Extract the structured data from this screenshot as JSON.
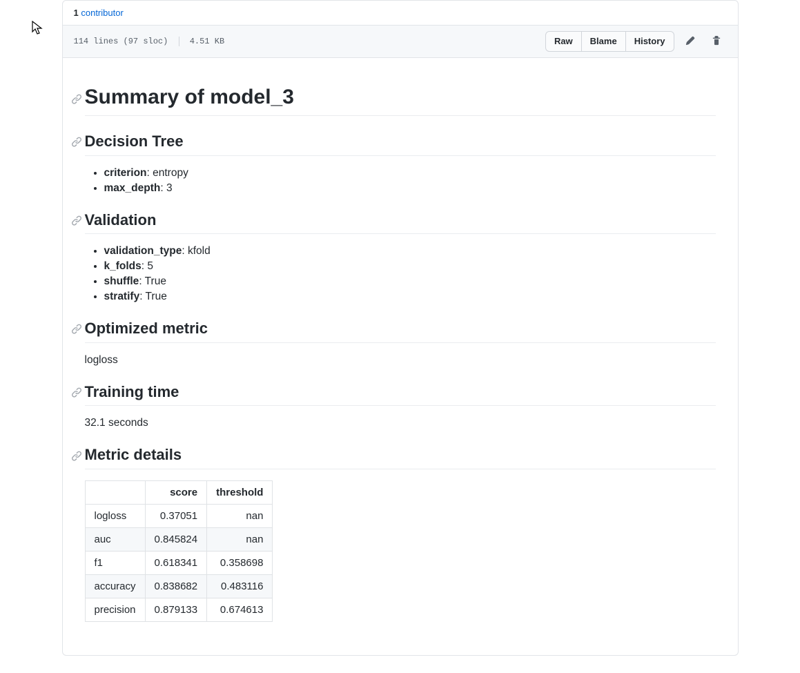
{
  "contrib": {
    "count": "1",
    "label": "contributor"
  },
  "file_info": {
    "lines_sloc": "114 lines (97 sloc)",
    "size": "4.51 KB"
  },
  "toolbar": {
    "raw": "Raw",
    "blame": "Blame",
    "history": "History"
  },
  "doc": {
    "h1": "Summary of model_3",
    "sections": {
      "decision_tree": {
        "heading": "Decision Tree",
        "items": [
          {
            "key": "criterion",
            "val": ": entropy"
          },
          {
            "key": "max_depth",
            "val": ": 3"
          }
        ]
      },
      "validation": {
        "heading": "Validation",
        "items": [
          {
            "key": "validation_type",
            "val": ": kfold"
          },
          {
            "key": "k_folds",
            "val": ": 5"
          },
          {
            "key": "shuffle",
            "val": ": True"
          },
          {
            "key": "stratify",
            "val": ": True"
          }
        ]
      },
      "optimized_metric": {
        "heading": "Optimized metric",
        "text": "logloss"
      },
      "training_time": {
        "heading": "Training time",
        "text": "32.1 seconds"
      },
      "metric_details": {
        "heading": "Metric details",
        "headers": [
          "",
          "score",
          "threshold"
        ],
        "rows": [
          [
            "logloss",
            "0.37051",
            "nan"
          ],
          [
            "auc",
            "0.845824",
            "nan"
          ],
          [
            "f1",
            "0.618341",
            "0.358698"
          ],
          [
            "accuracy",
            "0.838682",
            "0.483116"
          ],
          [
            "precision",
            "0.879133",
            "0.674613"
          ]
        ]
      }
    }
  }
}
